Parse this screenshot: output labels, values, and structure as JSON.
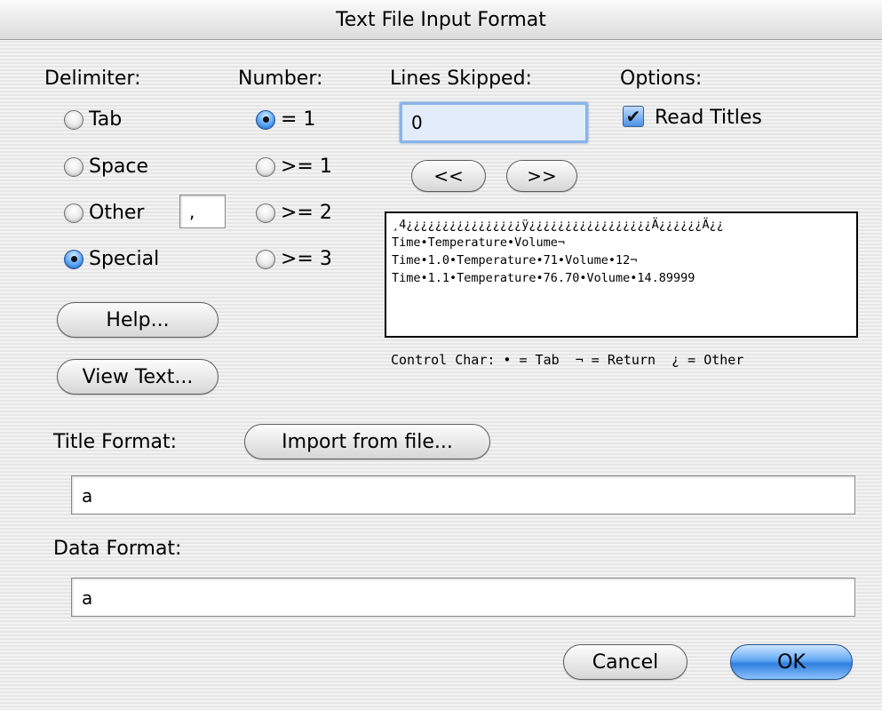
{
  "window": {
    "title": "Text File Input Format"
  },
  "delimiter": {
    "header": "Delimiter:",
    "options": [
      {
        "label": "Tab",
        "selected": false
      },
      {
        "label": "Space",
        "selected": false
      },
      {
        "label": "Other",
        "selected": false
      },
      {
        "label": "Special",
        "selected": true
      }
    ],
    "other_value": ","
  },
  "number": {
    "header": "Number:",
    "options": [
      {
        "label": "= 1",
        "selected": true
      },
      {
        "label": ">= 1",
        "selected": false
      },
      {
        "label": ">= 2",
        "selected": false
      },
      {
        "label": ">= 3",
        "selected": false
      }
    ]
  },
  "lines_skipped": {
    "header": "Lines Skipped:",
    "value": "0",
    "prev_label": "<<",
    "next_label": ">>"
  },
  "options": {
    "header": "Options:",
    "read_titles_label": "Read Titles",
    "read_titles_checked": true
  },
  "preview": {
    "lines": [
      "¸4¿¿¿¿¿¿¿¿¿¿¿¿¿¿¿¿ÿ¿¿¿¿¿¿¿¿¿¿¿¿¿¿¿¿¿Ä¿¿¿¿¿¿Ä¿¿",
      "Time•Temperature•Volume¬",
      "Time•1.0•Temperature•71•Volume•12¬",
      "Time•1.1•Temperature•76.70•Volume•14.89999"
    ],
    "legend": "Control Char: • = Tab  ¬ = Return  ¿ = Other"
  },
  "buttons": {
    "help": "Help...",
    "view_text": "View Text...",
    "import": "Import from file...",
    "cancel": "Cancel",
    "ok": "OK"
  },
  "title_format": {
    "label": "Title Format:",
    "value": "a"
  },
  "data_format": {
    "label": "Data Format:",
    "value": "a"
  },
  "colors": {
    "accent": "#2f7fe0",
    "focus_ring": "#8ab4e8"
  }
}
